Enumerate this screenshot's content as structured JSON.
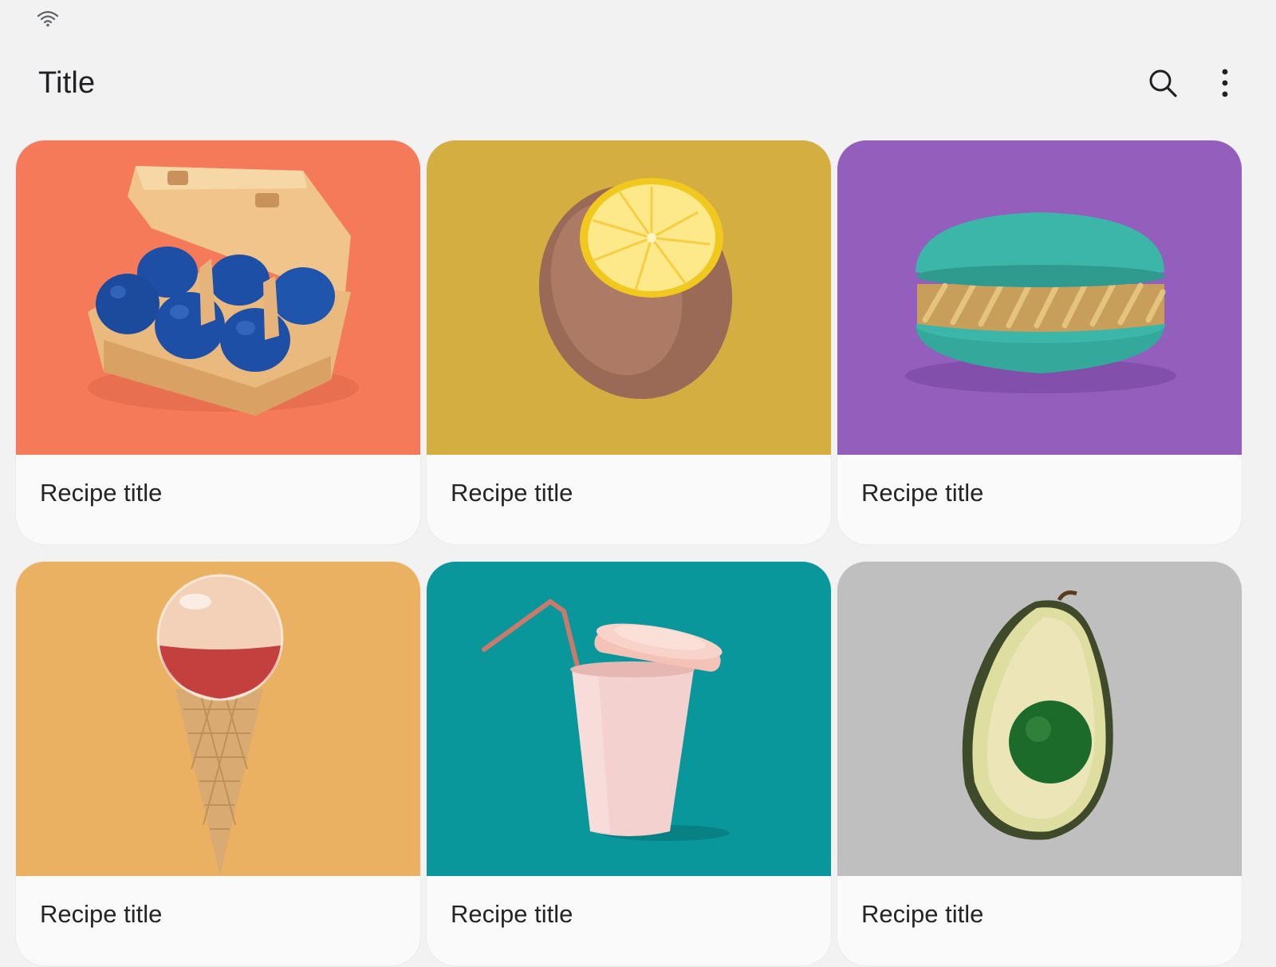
{
  "app_bar": {
    "title": "Title",
    "search_icon": "search-icon",
    "more_icon": "more-vert-icon"
  },
  "status_bar": {
    "wifi_icon": "wifi-icon"
  },
  "recipes": [
    {
      "title": "Recipe title",
      "image": "egg-carton-image",
      "bg": "#f47a5a"
    },
    {
      "title": "Recipe title",
      "image": "lemon-image",
      "bg": "#d4ae40"
    },
    {
      "title": "Recipe title",
      "image": "macaron-image",
      "bg": "#935ebc"
    },
    {
      "title": "Recipe title",
      "image": "ice-cream-cone-image",
      "bg": "#ebb163"
    },
    {
      "title": "Recipe title",
      "image": "cup-with-straw-image",
      "bg": "#0a979c"
    },
    {
      "title": "Recipe title",
      "image": "avocado-image",
      "bg": "#bfbfbf"
    }
  ]
}
